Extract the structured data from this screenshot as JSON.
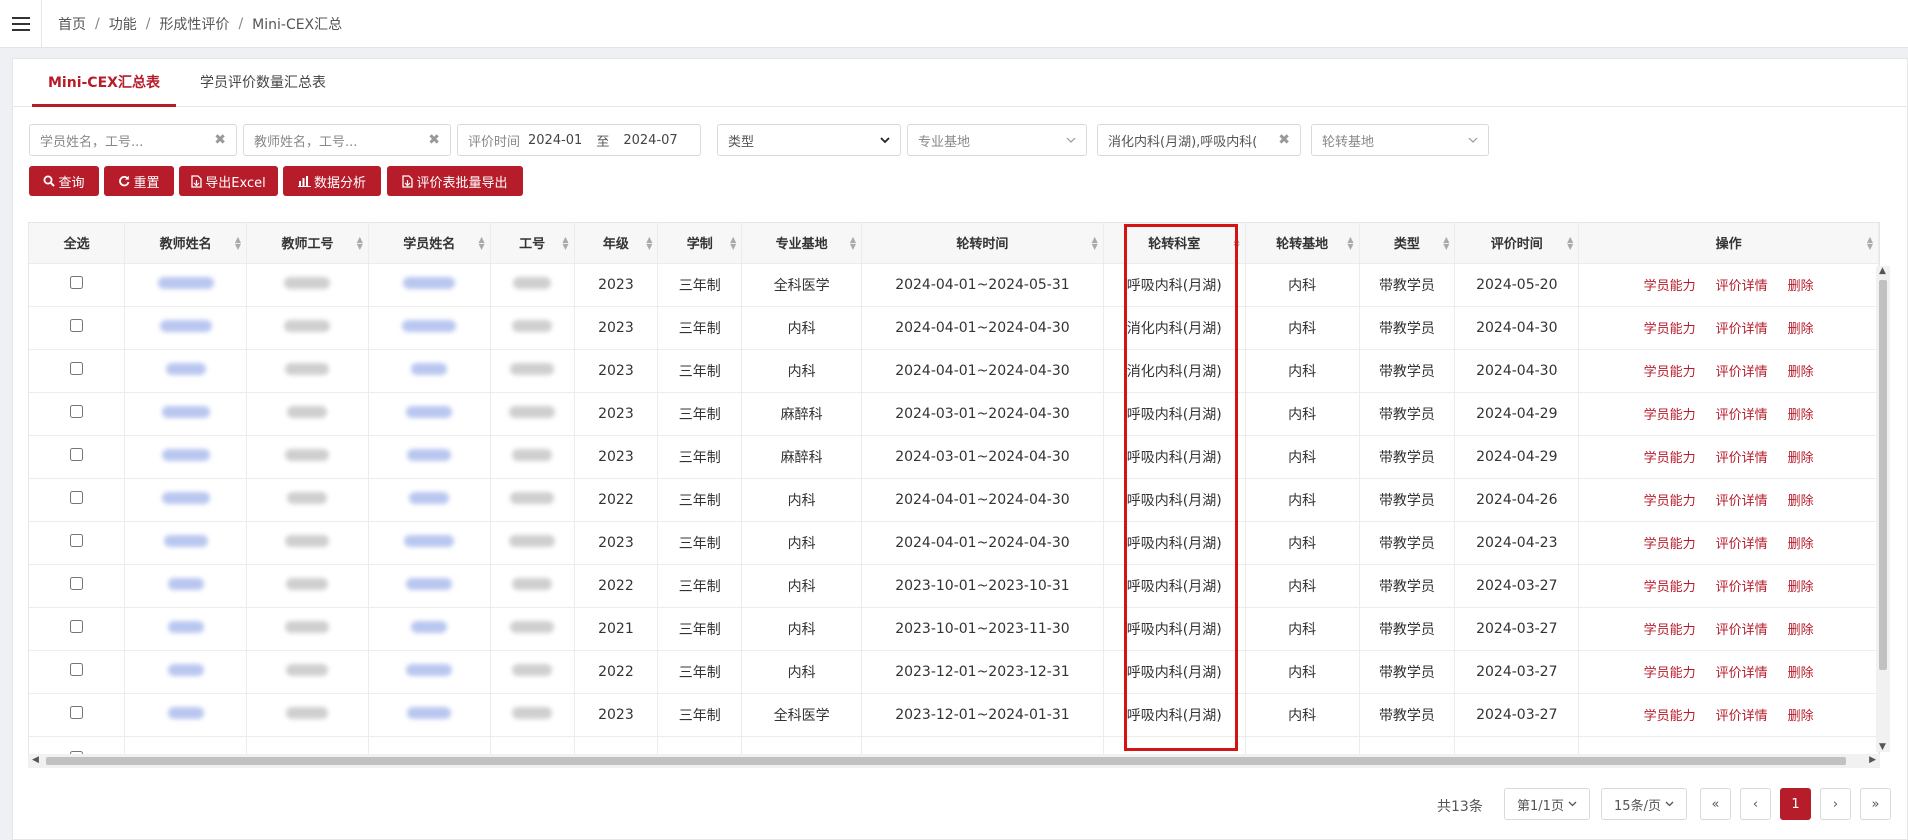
{
  "breadcrumb": [
    "首页",
    "功能",
    "形成性评价",
    "Mini-CEX汇总"
  ],
  "tabs": [
    "Mini-CEX汇总表",
    "学员评价数量汇总表"
  ],
  "filters": {
    "student_placeholder": "学员姓名，工号...",
    "teacher_placeholder": "教师姓名，工号...",
    "date_label": "评价时间",
    "date_from": "2024-01",
    "date_to_label": "至",
    "date_to": "2024-07",
    "type_placeholder": "类型",
    "base_placeholder": "专业基地",
    "dept_value": "消化内科(月湖),呼吸内科(",
    "rotation_base_placeholder": "轮转基地"
  },
  "buttons": {
    "query": "查询",
    "reset": "重置",
    "export_excel": "导出Excel",
    "analysis": "数据分析",
    "batch_export": "评价表批量导出"
  },
  "table": {
    "headers": [
      "全选",
      "教师姓名",
      "教师工号",
      "学员姓名",
      "工号",
      "年级",
      "学制",
      "专业基地",
      "轮转时间",
      "轮转科室",
      "轮转基地",
      "类型",
      "评价时间",
      "操作"
    ],
    "actions": [
      "学员能力",
      "评价详情",
      "删除"
    ],
    "rows": [
      {
        "grade": "2023",
        "system": "三年制",
        "base": "全科医学",
        "period": "2024-04-01~2024-05-31",
        "dept": "呼吸内科(月湖)",
        "rot_base": "内科",
        "type": "带教学员",
        "eval_date": "2024-05-20"
      },
      {
        "grade": "2023",
        "system": "三年制",
        "base": "内科",
        "period": "2024-04-01~2024-04-30",
        "dept": "消化内科(月湖)",
        "rot_base": "内科",
        "type": "带教学员",
        "eval_date": "2024-04-30"
      },
      {
        "grade": "2023",
        "system": "三年制",
        "base": "内科",
        "period": "2024-04-01~2024-04-30",
        "dept": "消化内科(月湖)",
        "rot_base": "内科",
        "type": "带教学员",
        "eval_date": "2024-04-30"
      },
      {
        "grade": "2023",
        "system": "三年制",
        "base": "麻醉科",
        "period": "2024-03-01~2024-04-30",
        "dept": "呼吸内科(月湖)",
        "rot_base": "内科",
        "type": "带教学员",
        "eval_date": "2024-04-29"
      },
      {
        "grade": "2023",
        "system": "三年制",
        "base": "麻醉科",
        "period": "2024-03-01~2024-04-30",
        "dept": "呼吸内科(月湖)",
        "rot_base": "内科",
        "type": "带教学员",
        "eval_date": "2024-04-29"
      },
      {
        "grade": "2022",
        "system": "三年制",
        "base": "内科",
        "period": "2024-04-01~2024-04-30",
        "dept": "呼吸内科(月湖)",
        "rot_base": "内科",
        "type": "带教学员",
        "eval_date": "2024-04-26"
      },
      {
        "grade": "2023",
        "system": "三年制",
        "base": "内科",
        "period": "2024-04-01~2024-04-30",
        "dept": "呼吸内科(月湖)",
        "rot_base": "内科",
        "type": "带教学员",
        "eval_date": "2024-04-23"
      },
      {
        "grade": "2022",
        "system": "三年制",
        "base": "内科",
        "period": "2023-10-01~2023-10-31",
        "dept": "呼吸内科(月湖)",
        "rot_base": "内科",
        "type": "带教学员",
        "eval_date": "2024-03-27"
      },
      {
        "grade": "2021",
        "system": "三年制",
        "base": "内科",
        "period": "2023-10-01~2023-11-30",
        "dept": "呼吸内科(月湖)",
        "rot_base": "内科",
        "type": "带教学员",
        "eval_date": "2024-03-27"
      },
      {
        "grade": "2022",
        "system": "三年制",
        "base": "内科",
        "period": "2023-12-01~2023-12-31",
        "dept": "呼吸内科(月湖)",
        "rot_base": "内科",
        "type": "带教学员",
        "eval_date": "2024-03-27"
      },
      {
        "grade": "2023",
        "system": "三年制",
        "base": "全科医学",
        "period": "2023-12-01~2024-01-31",
        "dept": "呼吸内科(月湖)",
        "rot_base": "内科",
        "type": "带教学员",
        "eval_date": "2024-03-27"
      }
    ]
  },
  "pagination": {
    "total": "共13条",
    "page_info": "第1/1页",
    "page_size": "15条/页",
    "current": "1",
    "first": "«",
    "prev": "‹",
    "next": "›",
    "last": "»"
  },
  "colors": {
    "accent": "#b71c2b",
    "highlight": "#d41414"
  }
}
